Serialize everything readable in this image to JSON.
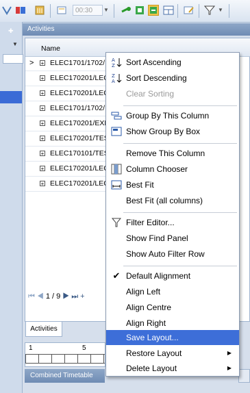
{
  "toolbar": {
    "time_value": "00:30",
    "icons": [
      "network-icon",
      "gantt-icon",
      "calendar-edit-icon",
      "time-icon",
      "link-icon",
      "record-icon",
      "export-icon",
      "layout-icon",
      "edit-icon",
      "filter-icon"
    ]
  },
  "panel": {
    "title": "Activities"
  },
  "grid": {
    "column_header": "Name",
    "rows": [
      "ELEC1701/1702/",
      "ELEC170201/LEC",
      "ELEC170201/LEC",
      "ELEC1701/1702/",
      "ELEC170201/EXP",
      "ELEC170201/TES",
      "ELEC170101/TES",
      "ELEC170201/LEC",
      "ELEC170201/LEC"
    ],
    "pager": "1 / 9"
  },
  "tabs": {
    "activities": "Activities"
  },
  "ruler": {
    "label_1": "1",
    "label_5": "5"
  },
  "bottom_tabs": {
    "combined": "Combined Timetable"
  },
  "context_menu": {
    "items": [
      {
        "label": "Sort Ascending",
        "icon": "sort-ascending-icon"
      },
      {
        "label": "Sort Descending",
        "icon": "sort-descending-icon"
      },
      {
        "label": "Clear Sorting",
        "disabled": true
      },
      {
        "label": "Group By This Column",
        "icon": "group-by-icon"
      },
      {
        "label": "Show Group By Box",
        "icon": "group-box-icon"
      },
      {
        "label": "Remove This Column"
      },
      {
        "label": "Column Chooser",
        "icon": "column-chooser-icon"
      },
      {
        "label": "Best Fit",
        "icon": "best-fit-icon"
      },
      {
        "label": "Best Fit (all columns)"
      },
      {
        "label": "Filter Editor...",
        "icon": "filter-icon"
      },
      {
        "label": "Show Find Panel"
      },
      {
        "label": "Show Auto Filter Row"
      },
      {
        "label": "Default Alignment",
        "icon": "checkmark-icon"
      },
      {
        "label": "Align Left"
      },
      {
        "label": "Align Centre"
      },
      {
        "label": "Align Right"
      },
      {
        "label": "Save Layout...",
        "highlighted": true
      },
      {
        "label": "Restore Layout",
        "submenu": true
      },
      {
        "label": "Delete Layout",
        "submenu": true
      }
    ]
  }
}
